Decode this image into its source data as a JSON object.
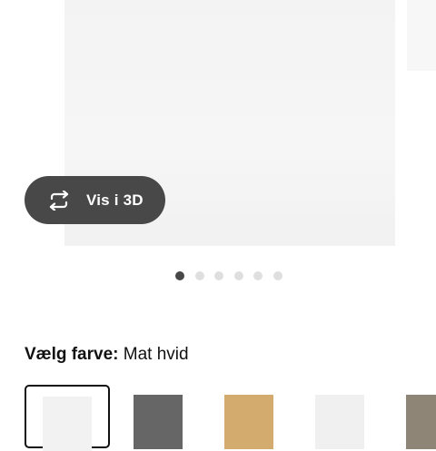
{
  "product": {
    "view_3d_label": "Vis i 3D",
    "view_3d_icon": "rotate-3d-icon",
    "image_count": 6,
    "active_image_index": 0
  },
  "color_selector": {
    "label": "Vælg farve:",
    "selected_value": "Mat hvid",
    "swatches": [
      {
        "color": "#f2f2f2",
        "selected": true
      },
      {
        "color": "#666666",
        "selected": false
      },
      {
        "color": "#d3ab6e",
        "selected": false
      },
      {
        "color": "#f0f0f0",
        "selected": false
      },
      {
        "color": "#8f8577",
        "selected": false
      }
    ]
  }
}
